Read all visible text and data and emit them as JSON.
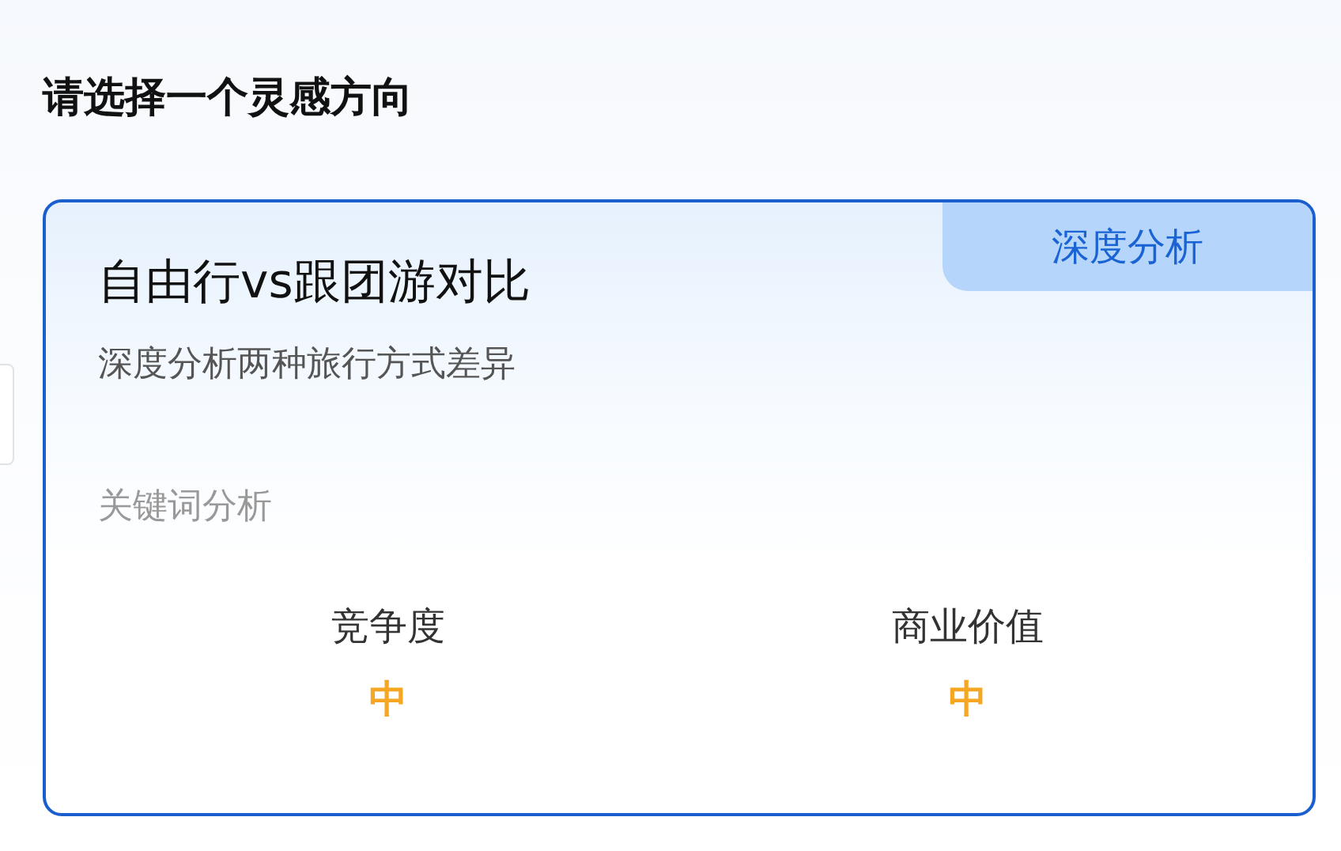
{
  "heading": "请选择一个灵感方向",
  "card": {
    "selected": true,
    "tag": "深度分析",
    "title": "自由行vs跟团游对比",
    "subtitle": "深度分析两种旅行方式差异",
    "section_label": "关键词分析",
    "metrics": [
      {
        "label": "竞争度",
        "value": "中"
      },
      {
        "label": "商业价值",
        "value": "中"
      }
    ]
  }
}
